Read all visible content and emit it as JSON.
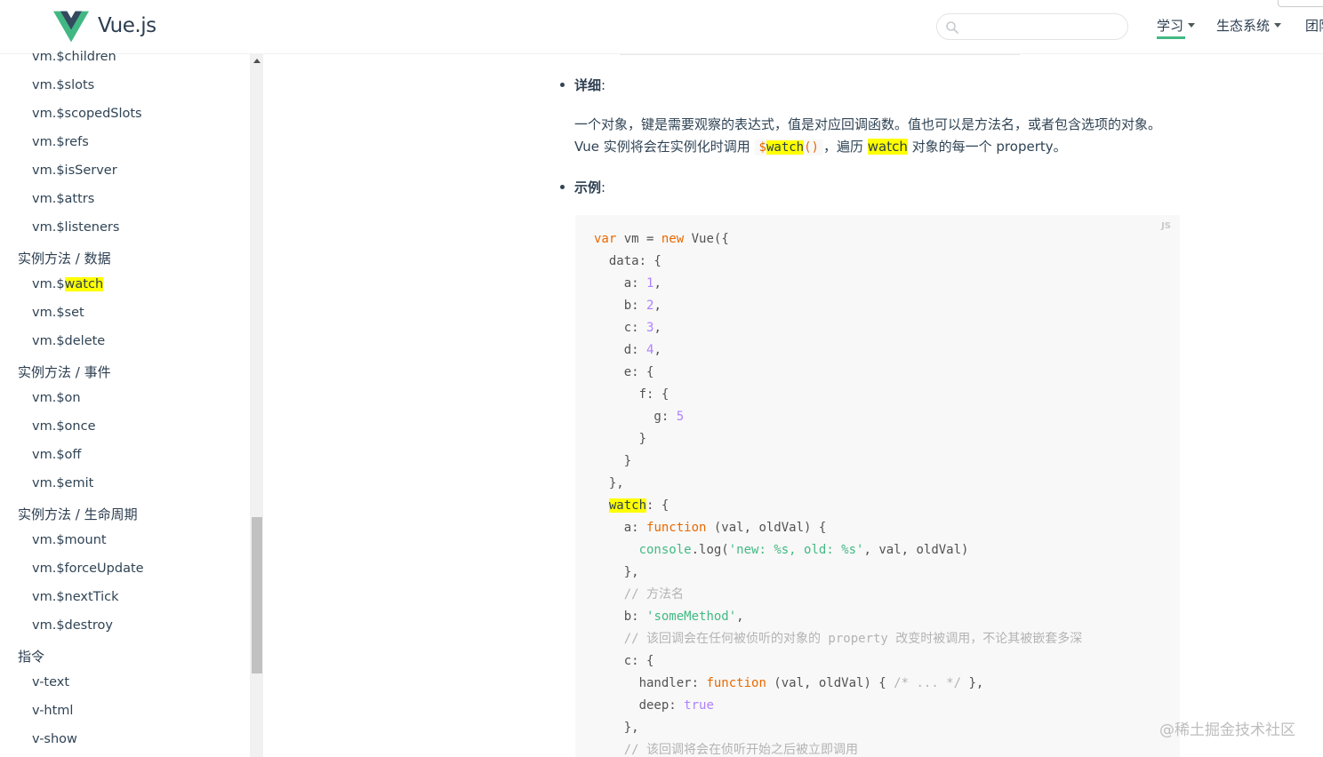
{
  "header": {
    "brand": "Vue.js",
    "search_value": "",
    "nav": [
      {
        "label": "学习"
      },
      {
        "label": "生态系统"
      },
      {
        "label": "团队"
      }
    ]
  },
  "sidebar": {
    "items": [
      {
        "label": "vm.$children",
        "level": "sub"
      },
      {
        "label": "vm.$slots",
        "level": "sub"
      },
      {
        "label": "vm.$scopedSlots",
        "level": "sub"
      },
      {
        "label": "vm.$refs",
        "level": "sub"
      },
      {
        "label": "vm.$isServer",
        "level": "sub"
      },
      {
        "label": "vm.$attrs",
        "level": "sub"
      },
      {
        "label": "vm.$listeners",
        "level": "sub"
      },
      {
        "label": "实例方法 / 数据",
        "level": "head"
      },
      {
        "label_prefix": "vm.$",
        "label_highlight": "watch",
        "level": "sub"
      },
      {
        "label": "vm.$set",
        "level": "sub"
      },
      {
        "label": "vm.$delete",
        "level": "sub"
      },
      {
        "label": "实例方法 / 事件",
        "level": "head"
      },
      {
        "label": "vm.$on",
        "level": "sub"
      },
      {
        "label": "vm.$once",
        "level": "sub"
      },
      {
        "label": "vm.$off",
        "level": "sub"
      },
      {
        "label": "vm.$emit",
        "level": "sub"
      },
      {
        "label": "实例方法 / 生命周期",
        "level": "head"
      },
      {
        "label": "vm.$mount",
        "level": "sub"
      },
      {
        "label": "vm.$forceUpdate",
        "level": "sub"
      },
      {
        "label": "vm.$nextTick",
        "level": "sub"
      },
      {
        "label": "vm.$destroy",
        "level": "sub"
      },
      {
        "label": "指令",
        "level": "head"
      },
      {
        "label": "v-text",
        "level": "sub"
      },
      {
        "label": "v-html",
        "level": "sub"
      },
      {
        "label": "v-show",
        "level": "sub"
      }
    ]
  },
  "main": {
    "details_label": "详细",
    "details_colon": ":",
    "para": {
      "part1": "一个对象，键是需要观察的表达式，值是对应回调函数。值也可以是方法名，或者包含选项的对象。Vue 实例将会在实例化时调用 ",
      "code_dollar": "$",
      "code_hl": "watch",
      "code_parens": "()",
      "part2": "，遍历 ",
      "hl2": "watch",
      "part3": " 对象的每一个 property。"
    },
    "example_label": "示例",
    "example_colon": ":",
    "code_lang": "JS",
    "code_lines": [
      [
        [
          "kw",
          "var"
        ],
        [
          "p",
          " vm = "
        ],
        [
          "kw",
          "new"
        ],
        [
          "p",
          " Vue({"
        ]
      ],
      [
        [
          "p",
          "  data: {"
        ]
      ],
      [
        [
          "p",
          "    a: "
        ],
        [
          "num",
          "1"
        ],
        [
          "p",
          ","
        ]
      ],
      [
        [
          "p",
          "    b: "
        ],
        [
          "num",
          "2"
        ],
        [
          "p",
          ","
        ]
      ],
      [
        [
          "p",
          "    c: "
        ],
        [
          "num",
          "3"
        ],
        [
          "p",
          ","
        ]
      ],
      [
        [
          "p",
          "    d: "
        ],
        [
          "num",
          "4"
        ],
        [
          "p",
          ","
        ]
      ],
      [
        [
          "p",
          "    e: {"
        ]
      ],
      [
        [
          "p",
          "      f: {"
        ]
      ],
      [
        [
          "p",
          "        g: "
        ],
        [
          "num",
          "5"
        ]
      ],
      [
        [
          "p",
          "      }"
        ]
      ],
      [
        [
          "p",
          "    }"
        ]
      ],
      [
        [
          "p",
          "  },"
        ]
      ],
      [
        [
          "p",
          "  "
        ],
        [
          "hl",
          "watch"
        ],
        [
          "p",
          ": {"
        ]
      ],
      [
        [
          "p",
          "    a: "
        ],
        [
          "fn",
          "function"
        ],
        [
          "p",
          " (val, oldVal) {"
        ]
      ],
      [
        [
          "p",
          "      "
        ],
        [
          "con",
          "console"
        ],
        [
          "p",
          ".log("
        ],
        [
          "str",
          "'new: %s, old: %s'"
        ],
        [
          "p",
          ", val, oldVal)"
        ]
      ],
      [
        [
          "p",
          "    },"
        ]
      ],
      [
        [
          "com",
          "    // 方法名"
        ]
      ],
      [
        [
          "p",
          "    b: "
        ],
        [
          "str",
          "'someMethod'"
        ],
        [
          "p",
          ","
        ]
      ],
      [
        [
          "com",
          "    // 该回调会在任何被侦听的对象的 property 改变时被调用，不论其被嵌套多深"
        ]
      ],
      [
        [
          "p",
          "    c: {"
        ]
      ],
      [
        [
          "p",
          "      handler: "
        ],
        [
          "fn",
          "function"
        ],
        [
          "p",
          " (val, oldVal) { "
        ],
        [
          "com",
          "/* ... */"
        ],
        [
          "p",
          " },"
        ]
      ],
      [
        [
          "p",
          "      deep: "
        ],
        [
          "num",
          "true"
        ]
      ],
      [
        [
          "p",
          "    },"
        ]
      ],
      [
        [
          "com",
          "    // 该回调将会在侦听开始之后被立即调用"
        ]
      ]
    ]
  },
  "watermark": "@稀土掘金技术社区",
  "colors": {
    "accent": "#42b983",
    "highlight": "#ffff00",
    "text": "#304455"
  }
}
